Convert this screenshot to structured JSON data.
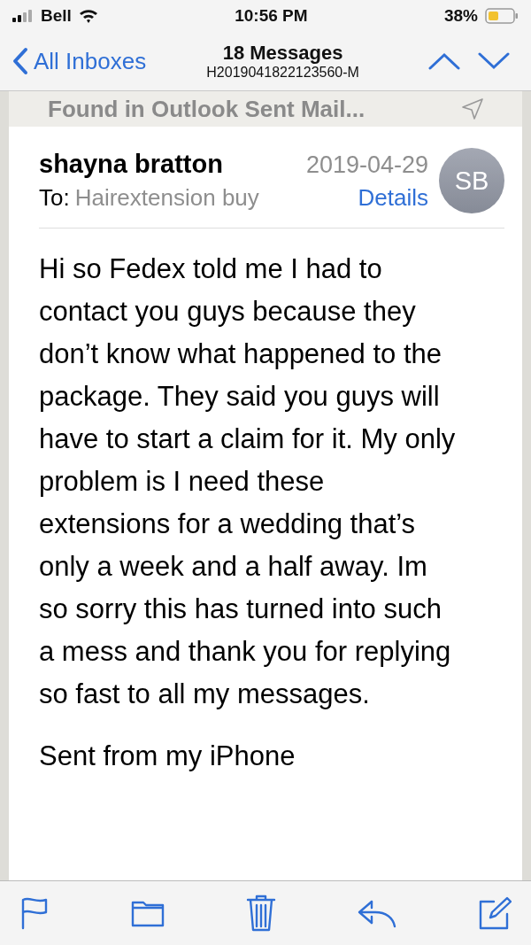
{
  "status_bar": {
    "carrier": "Bell",
    "time": "10:56 PM",
    "battery": "38%"
  },
  "nav": {
    "back": "All Inboxes",
    "title": "18 Messages",
    "subtitle": "H2019041822123560-M"
  },
  "mailbox_banner": "Found in Outlook Sent Mail...",
  "message": {
    "sender": "shayna bratton",
    "date": "2019-04-29",
    "to_label": "To:",
    "recipient": "Hairextension buy",
    "details": "Details",
    "avatar": "SB",
    "body": [
      "Hi so Fedex told me I had to contact you guys because they don’t know what happened to the package. They said you guys will have to start a claim for it. My only problem is I need these extensions for a wedding that’s only a week and a half away. Im so sorry this has turned into such a mess and thank you for replying so fast to all my messages.",
      "Sent from my iPhone"
    ]
  },
  "toolbar": [
    {
      "kind": "flag"
    },
    {
      "kind": "folder"
    },
    {
      "kind": "trash"
    },
    {
      "kind": "reply"
    },
    {
      "kind": "compose"
    }
  ]
}
